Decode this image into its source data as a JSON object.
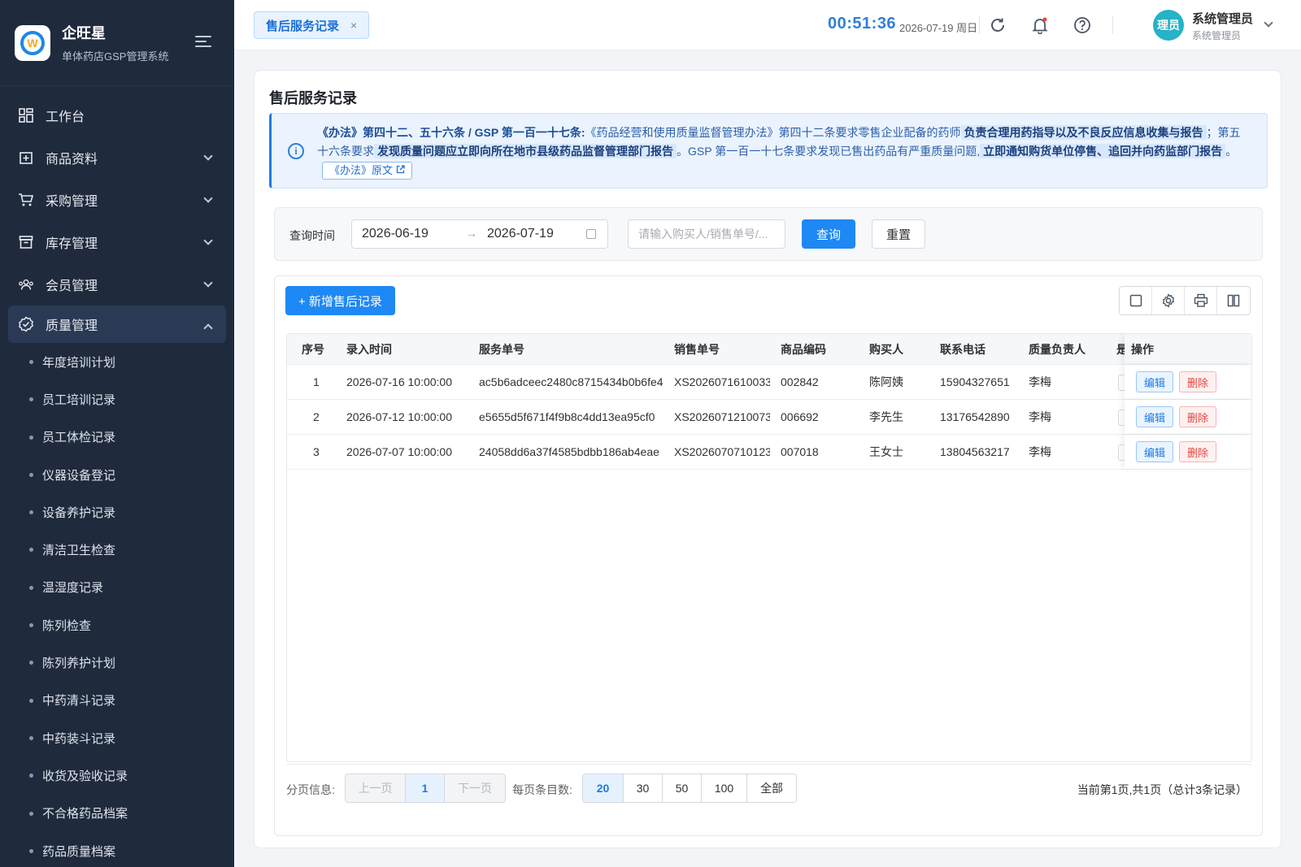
{
  "app": {
    "name": "企旺星",
    "subtitle": "单体药店GSP管理系统",
    "logo_letter": "W"
  },
  "sidebar": {
    "items": [
      {
        "label": "工作台",
        "icon": "dashboard-icon"
      },
      {
        "label": "商品资料",
        "icon": "product-icon"
      },
      {
        "label": "采购管理",
        "icon": "cart-icon"
      },
      {
        "label": "库存管理",
        "icon": "inventory-icon"
      },
      {
        "label": "会员管理",
        "icon": "members-icon"
      },
      {
        "label": "质量管理",
        "icon": "quality-icon"
      }
    ],
    "quality_subitems": [
      "年度培训计划",
      "员工培训记录",
      "员工体检记录",
      "仪器设备登记",
      "设备养护记录",
      "清洁卫生检查",
      "温湿度记录",
      "陈列检查",
      "陈列养护计划",
      "中药清斗记录",
      "中药装斗记录",
      "收货及验收记录",
      "不合格药品档案",
      "药品质量档案"
    ]
  },
  "header": {
    "tab_label": "售后服务记录",
    "tab_close": "×",
    "clock": "00:51:36",
    "date": "2026-07-19 周日",
    "avatar_text": "理员",
    "user_name": "系统管理员",
    "user_role": "系统管理员"
  },
  "page": {
    "title": "售后服务记录",
    "notice": {
      "lead": "《办法》第四十二、五十六条 / GSP 第一百一十七条:",
      "t1": "《药品经营和使用质量监督管理办法》第四十二条要求零售企业配备的药师",
      "h1": "负责合理用药指导以及不良反应信息收集与报告",
      "t2": "；第五十六条要求",
      "h2": "发现质量问题应立即向所在地市县级药品监督管理部门报告",
      "t3": "。GSP 第一百一十七条要求发现已售出药品有严重质量问题,",
      "h3": "立即通知购货单位停售、追回并向药监部门报告",
      "t4": "。",
      "link": "《办法》原文"
    }
  },
  "filter": {
    "label": "查询时间",
    "start_date": "2026-06-19",
    "end_date": "2026-07-19",
    "arrow": "→",
    "search_placeholder": "请输入购买人/销售单号/...",
    "search_value": "",
    "query_label": "查询",
    "reset_label": "重置"
  },
  "table": {
    "add_label": "+ 新增售后记录",
    "columns": [
      "序号",
      "录入时间",
      "服务单号",
      "销售单号",
      "商品编码",
      "购买人",
      "联系电话",
      "质量负责人",
      "是",
      "操作"
    ],
    "rows": [
      {
        "no": "1",
        "time": "2026-07-16 10:00:00",
        "service_no": "ac5b6adceec2480c8715434b0b6fe4",
        "sale_no": "XS2026071610033",
        "code": "002842",
        "buyer": "陈阿姨",
        "phone": "15904327651",
        "manager": "李梅"
      },
      {
        "no": "2",
        "time": "2026-07-12 10:00:00",
        "service_no": "e5655d5f671f4f9b8c4dd13ea95cf0",
        "sale_no": "XS2026071210073",
        "code": "006692",
        "buyer": "李先生",
        "phone": "13176542890",
        "manager": "李梅"
      },
      {
        "no": "3",
        "time": "2026-07-07 10:00:00",
        "service_no": "24058dd6a37f4585bdbb186ab4eae",
        "sale_no": "XS2026070710123",
        "code": "007018",
        "buyer": "王女士",
        "phone": "13804563217",
        "manager": "李梅"
      }
    ],
    "edit_label": "编辑",
    "delete_label": "删除"
  },
  "pager": {
    "label": "分页信息:",
    "prev": "上一页",
    "current": "1",
    "next": "下一页",
    "size_label": "每页条目数:",
    "sizes": [
      "20",
      "30",
      "50",
      "100",
      "全部"
    ],
    "selected_size": "20",
    "info": "当前第1页,共1页（总计3条记录）"
  },
  "colors": {
    "sidebar_bg": "#1f2a3d",
    "primary": "#1e88f5",
    "danger": "#e0463f"
  }
}
